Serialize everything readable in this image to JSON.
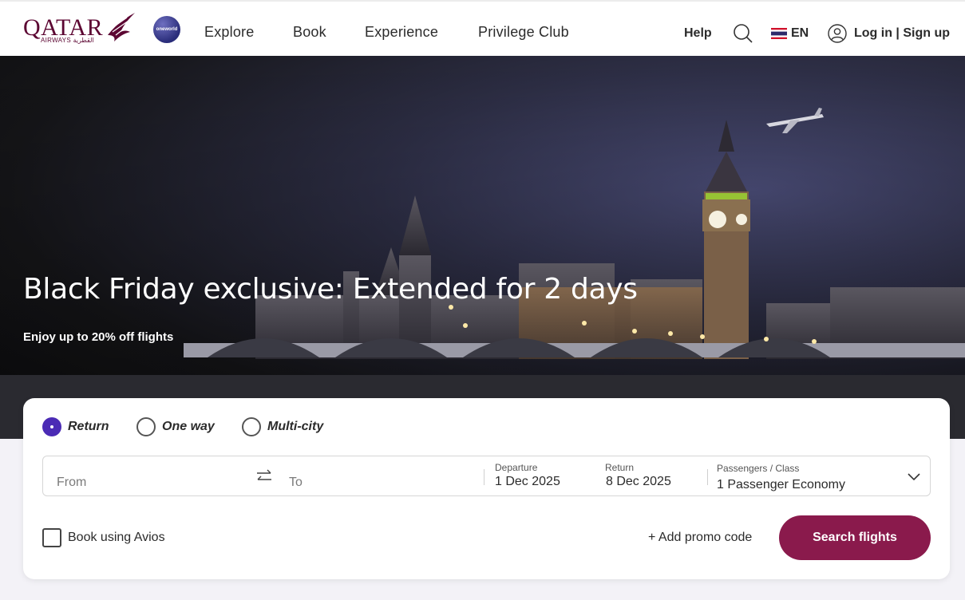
{
  "header": {
    "logo_text": "QATAR",
    "logo_sub": "AIRWAYS القطرية",
    "oneworld_label": "oneworld",
    "nav": [
      {
        "label": "Explore"
      },
      {
        "label": "Book"
      },
      {
        "label": "Experience"
      },
      {
        "label": "Privilege Club"
      }
    ],
    "help": "Help",
    "lang": "EN",
    "login": "Log in | Sign up"
  },
  "hero": {
    "title": "Black Friday exclusive: Extended for 2 days",
    "subtitle": "Enjoy up to 20% off flights"
  },
  "booking": {
    "trip_types": [
      {
        "label": "Return",
        "selected": true
      },
      {
        "label": "One way",
        "selected": false
      },
      {
        "label": "Multi-city",
        "selected": false
      }
    ],
    "from_placeholder": "From",
    "to_placeholder": "To",
    "departure_label": "Departure",
    "departure_value": "1 Dec 2025",
    "return_label": "Return",
    "return_value": "8 Dec 2025",
    "passengers_label": "Passengers / Class",
    "passengers_value": "1  Passenger Economy",
    "avios_label": "Book using Avios",
    "promo_label": "+ Add promo code",
    "search_label": "Search flights"
  },
  "colors": {
    "brand": "#5c0632",
    "button": "#8a1a4c",
    "radio_selected": "#4b2bb5"
  }
}
